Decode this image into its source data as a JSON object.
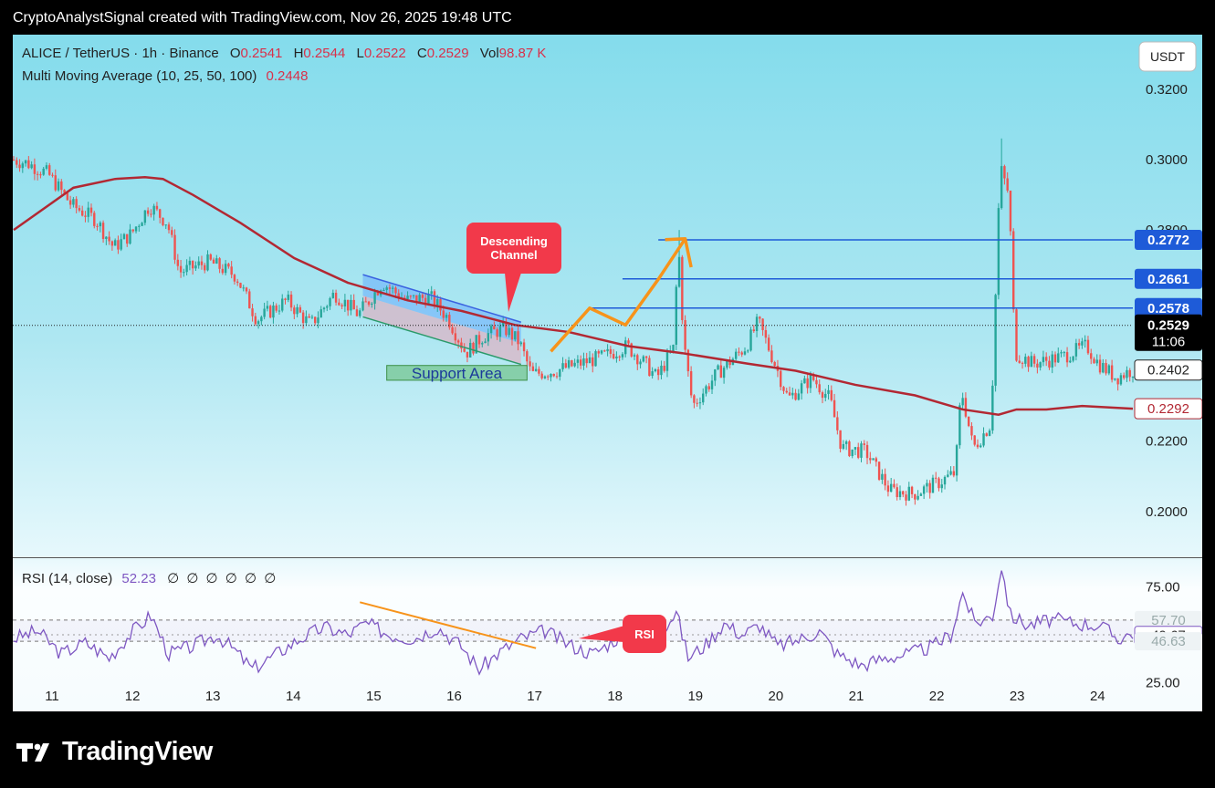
{
  "header": {
    "credit": "CryptoAnalystSignal created with TradingView.com, Nov 26, 2025 19:48 UTC"
  },
  "legend": {
    "symbol": "ALICE / TetherUS · 1h · Binance",
    "o_label": "O",
    "o": "0.2541",
    "h_label": "H",
    "h": "0.2544",
    "l_label": "L",
    "l": "0.2522",
    "c_label": "C",
    "c": "0.2529",
    "vol_label": "Vol",
    "vol": "98.87 K",
    "ma_label": "Multi Moving Average (10, 25, 50, 100)",
    "ma_value": "0.2448",
    "rsi_label": "RSI (14, close)",
    "rsi_value": "52.23",
    "rsi_extra": "∅ ∅ ∅ ∅ ∅ ∅"
  },
  "currency_button": "USDT",
  "footer": {
    "brand": "TradingView"
  },
  "colors": {
    "bull": "#26a69a",
    "bear": "#ef5350",
    "ma": "#b22833",
    "level": "#1e5bd8",
    "orange": "#f7931a",
    "rsi": "#7e57c2",
    "callout": "#f2394a",
    "support": "#4caf50"
  },
  "chart_data": {
    "type": "candlestick",
    "x_ticks": [
      "11",
      "12",
      "13",
      "14",
      "15",
      "16",
      "17",
      "18",
      "19",
      "20",
      "21",
      "22",
      "23",
      "24"
    ],
    "y_ticks": [
      "0.3200",
      "0.3000",
      "0.2800",
      "0.2200",
      "0.2000"
    ],
    "ylim": [
      0.187,
      0.3355
    ],
    "price_path": [
      [
        0,
        0.3
      ],
      [
        5,
        0.299
      ],
      [
        12,
        0.296
      ],
      [
        20,
        0.287
      ],
      [
        28,
        0.283
      ],
      [
        34,
        0.275
      ],
      [
        40,
        0.279
      ],
      [
        46,
        0.287
      ],
      [
        52,
        0.282
      ],
      [
        56,
        0.268
      ],
      [
        66,
        0.271
      ],
      [
        75,
        0.267
      ],
      [
        82,
        0.2545
      ],
      [
        92,
        0.26
      ],
      [
        100,
        0.253
      ],
      [
        108,
        0.262
      ],
      [
        116,
        0.256
      ],
      [
        124,
        0.265
      ],
      [
        132,
        0.26
      ],
      [
        140,
        0.261
      ],
      [
        146,
        0.255
      ],
      [
        152,
        0.245
      ],
      [
        158,
        0.25
      ],
      [
        165,
        0.252
      ],
      [
        170,
        0.248
      ],
      [
        174,
        0.239
      ],
      [
        182,
        0.24
      ],
      [
        190,
        0.242
      ],
      [
        198,
        0.244
      ],
      [
        206,
        0.247
      ],
      [
        212,
        0.242
      ],
      [
        216,
        0.238
      ],
      [
        222,
        0.247
      ],
      [
        223,
        0.28
      ],
      [
        225,
        0.248
      ],
      [
        228,
        0.23
      ],
      [
        236,
        0.239
      ],
      [
        246,
        0.247
      ],
      [
        250,
        0.254
      ],
      [
        256,
        0.241
      ],
      [
        260,
        0.232
      ],
      [
        268,
        0.238
      ],
      [
        274,
        0.232
      ],
      [
        278,
        0.218
      ],
      [
        286,
        0.217
      ],
      [
        294,
        0.206
      ],
      [
        302,
        0.205
      ],
      [
        310,
        0.208
      ],
      [
        316,
        0.211
      ],
      [
        318,
        0.235
      ],
      [
        322,
        0.218
      ],
      [
        328,
        0.225
      ],
      [
        331,
        0.298
      ],
      [
        334,
        0.29
      ],
      [
        336,
        0.245
      ],
      [
        342,
        0.242
      ],
      [
        352,
        0.244
      ],
      [
        360,
        0.247
      ],
      [
        364,
        0.242
      ],
      [
        370,
        0.238
      ],
      [
        375,
        0.2402
      ]
    ],
    "spikes": [
      [
        223,
        0.28
      ],
      [
        331,
        0.306
      ],
      [
        334,
        0.29
      ]
    ],
    "ma_line": [
      [
        0,
        0.28
      ],
      [
        20,
        0.292
      ],
      [
        34,
        0.2945
      ],
      [
        44,
        0.295
      ],
      [
        50,
        0.2945
      ],
      [
        60,
        0.29
      ],
      [
        76,
        0.282
      ],
      [
        94,
        0.272
      ],
      [
        112,
        0.265
      ],
      [
        132,
        0.26
      ],
      [
        150,
        0.257
      ],
      [
        168,
        0.253
      ],
      [
        186,
        0.251
      ],
      [
        206,
        0.247
      ],
      [
        224,
        0.245
      ],
      [
        246,
        0.242
      ],
      [
        262,
        0.24
      ],
      [
        282,
        0.236
      ],
      [
        302,
        0.233
      ],
      [
        318,
        0.229
      ],
      [
        330,
        0.2275
      ],
      [
        336,
        0.229
      ],
      [
        346,
        0.229
      ],
      [
        358,
        0.23
      ],
      [
        375,
        0.2292
      ]
    ],
    "horizontal_levels": [
      {
        "price": 0.2772,
        "label": "0.2772",
        "x_start": 216
      },
      {
        "price": 0.2661,
        "label": "0.2661",
        "x_start": 204
      },
      {
        "price": 0.2578,
        "label": "0.2578",
        "x_start": 193
      }
    ],
    "current_price": {
      "price": 0.2529,
      "label": "0.2529",
      "countdown": "11:06"
    },
    "last_close_label": {
      "price": 0.2402,
      "label": "0.2402"
    },
    "ma_label": {
      "price": 0.2292,
      "label": "0.2292"
    },
    "descending_channel": {
      "upper": [
        [
          117,
          0.2673
        ],
        [
          170,
          0.2538
        ]
      ],
      "lower": [
        [
          117,
          0.2553
        ],
        [
          170,
          0.2418
        ]
      ],
      "label": "Descending Channel"
    },
    "support_area": {
      "label": "Support Area",
      "x0": 125,
      "x1": 172,
      "y0": 0.2415,
      "y1": 0.2373
    },
    "projection_path": [
      [
        180,
        0.2455
      ],
      [
        193,
        0.2578
      ],
      [
        205,
        0.253
      ],
      [
        216,
        0.266
      ],
      [
        225,
        0.2775
      ],
      [
        227,
        0.272
      ]
    ],
    "rsi": {
      "ticks": [
        "75.00",
        "25.00"
      ],
      "ylim": [
        10,
        90
      ],
      "bands": [
        57.7,
        46.63
      ],
      "mid": 50,
      "labels": [
        "57.70",
        "49.67",
        "46.63"
      ],
      "trend": [
        [
          116,
          67
        ],
        [
          175,
          43
        ]
      ],
      "callout": "RSI",
      "path": [
        [
          0,
          48
        ],
        [
          8,
          52
        ],
        [
          16,
          40
        ],
        [
          24,
          46
        ],
        [
          32,
          38
        ],
        [
          40,
          52
        ],
        [
          46,
          60
        ],
        [
          52,
          40
        ],
        [
          60,
          44
        ],
        [
          68,
          50
        ],
        [
          74,
          42
        ],
        [
          80,
          32
        ],
        [
          88,
          40
        ],
        [
          96,
          48
        ],
        [
          104,
          54
        ],
        [
          112,
          50
        ],
        [
          118,
          56
        ],
        [
          126,
          50
        ],
        [
          134,
          48
        ],
        [
          142,
          54
        ],
        [
          150,
          44
        ],
        [
          156,
          32
        ],
        [
          162,
          40
        ],
        [
          170,
          48
        ],
        [
          178,
          52
        ],
        [
          186,
          45
        ],
        [
          194,
          40
        ],
        [
          202,
          48
        ],
        [
          210,
          55
        ],
        [
          216,
          50
        ],
        [
          222,
          62
        ],
        [
          226,
          38
        ],
        [
          232,
          45
        ],
        [
          238,
          56
        ],
        [
          244,
          50
        ],
        [
          250,
          55
        ],
        [
          256,
          44
        ],
        [
          264,
          48
        ],
        [
          270,
          52
        ],
        [
          276,
          40
        ],
        [
          284,
          34
        ],
        [
          292,
          38
        ],
        [
          300,
          40
        ],
        [
          308,
          44
        ],
        [
          314,
          50
        ],
        [
          318,
          72
        ],
        [
          322,
          56
        ],
        [
          328,
          60
        ],
        [
          331,
          86
        ],
        [
          334,
          60
        ],
        [
          340,
          55
        ],
        [
          348,
          58
        ],
        [
          356,
          56
        ],
        [
          364,
          55
        ],
        [
          370,
          48
        ],
        [
          375,
          51
        ]
      ]
    }
  }
}
